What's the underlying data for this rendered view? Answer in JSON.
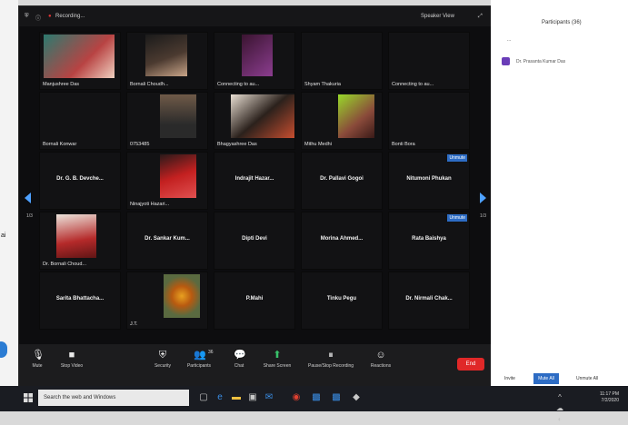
{
  "zoom": {
    "recording_label": "Recording...",
    "speaker_view_label": "Speaker View",
    "participants_top": [
      {
        "name": "Manjushree Das",
        "video": "face-red"
      },
      {
        "name": "Bornali Choudh...",
        "video": "face-dark"
      },
      {
        "name": "Connecting to au...",
        "video": "pink"
      },
      {
        "name": "Shyam Thakuria",
        "video": "none"
      },
      {
        "name": "Connecting to au...",
        "video": "none"
      }
    ],
    "row2": [
      {
        "name": "Bornali Konwar",
        "video": "none"
      },
      {
        "name": "0753485",
        "video": "room"
      },
      {
        "name": "Bhagyashree Das",
        "video": "face-dark2"
      },
      {
        "name": "Mithu Medhi",
        "video": "face-green"
      },
      {
        "name": "Bonti Bora",
        "video": "none"
      }
    ],
    "row3": [
      {
        "center": "Dr. G. B. Devche...",
        "video": "none"
      },
      {
        "name": "Ninajyoti Hazari...",
        "video": "red"
      },
      {
        "center": "Indrajit Hazar...",
        "video": "none"
      },
      {
        "center": "Dr. Pallavi Gogoi",
        "video": "none"
      },
      {
        "center": "Nitumoni Phukan",
        "video": "none",
        "badge": "Unmute"
      }
    ],
    "row4": [
      {
        "name": "Dr. Bornali Choud...",
        "video": "face-red2"
      },
      {
        "center": "Dr. Sankar Kum...",
        "video": "none"
      },
      {
        "center": "Dipti Devi",
        "video": "none"
      },
      {
        "center": "Morina Ahmed...",
        "video": "none"
      },
      {
        "center": "Rata Baishya",
        "video": "none",
        "badge": "Unmute"
      }
    ],
    "row5": [
      {
        "center": "Sarita Bhattacha...",
        "video": "none"
      },
      {
        "name": "J.T.",
        "video": "flower"
      },
      {
        "center": "P.Mahi",
        "video": "none"
      },
      {
        "center": "Tinku Pegu",
        "video": "none"
      },
      {
        "center": "Dr. Nirmali Chak...",
        "video": "none"
      }
    ],
    "page_left": "1/3",
    "page_right": "1/3",
    "toolbar": {
      "mute": "Mute",
      "stop_video": "Stop Video",
      "security": "Security",
      "participants": "Participants",
      "participants_count": "36",
      "chat": "Chat",
      "share_screen": "Share Screen",
      "pause_recording": "Pause/Stop Recording",
      "reactions": "Reactions",
      "end": "End"
    }
  },
  "panel": {
    "title": "Participants (36)",
    "small_label": "...",
    "first_participant": "Dr. Prasanta Kumar Das",
    "footer_invite": "Invite",
    "footer_mute_all": "Mute All",
    "footer_more": "Unmute All"
  },
  "taskbar": {
    "search_placeholder": "Search the web and Windows",
    "time": "11:17 PM",
    "date": "7/2/2020"
  },
  "left_strip": {
    "text": "ai"
  }
}
